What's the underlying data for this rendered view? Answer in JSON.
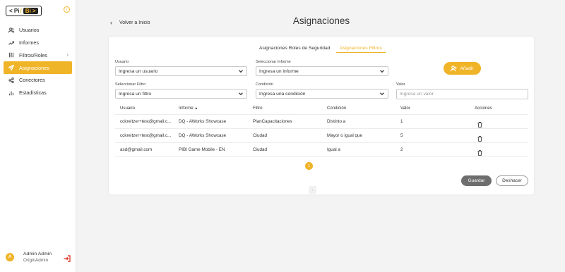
{
  "logo": {
    "pi": "< Pi",
    "slash": "/",
    "bi": "Bi >"
  },
  "sidebar": {
    "items": [
      {
        "label": "Usuarios",
        "icon": "users-icon"
      },
      {
        "label": "Informes",
        "icon": "trend-icon"
      },
      {
        "label": "Filtros/Roles",
        "icon": "sliders-icon"
      },
      {
        "label": "Asignaciones",
        "icon": "send-icon"
      },
      {
        "label": "Conectores",
        "icon": "share-icon"
      },
      {
        "label": "Estadísticas",
        "icon": "bar-chart-icon"
      }
    ],
    "active": "Asignaciones"
  },
  "user": {
    "initial": "A",
    "name": "Admin Admin",
    "role": "OriginAdmin"
  },
  "header": {
    "back_label": "Volver a Inicio",
    "title": "Asignaciones"
  },
  "tabs": [
    "Asignaciones Roles de Seguridad",
    "Asignaciones Filtros"
  ],
  "form": {
    "usuario_label": "Usuario",
    "usuario_value": "Ingresa un usuario",
    "informe_label": "Seleccionar Informe",
    "informe_value": "Ingresa un informe",
    "filtro_label": "Seleccionar Filtro",
    "filtro_value": "Ingresa un filtro",
    "condicion_label": "Condición",
    "condicion_value": "Ingresa una condición",
    "valor_label": "Valor",
    "valor_placeholder": "Ingresa un valor",
    "add_label": "Añadir"
  },
  "table": {
    "headers": [
      "Usuario",
      "Informe",
      "Filtro",
      "Condición",
      "Valor",
      "Acciones"
    ],
    "sort_indicator": "▲",
    "rows": [
      {
        "usuario": "cckreitzer+test@gmail.c...",
        "informe": "DQ - AWorks Showcase",
        "filtro": "PlanCapacitaciones",
        "condicion": "Distinto a",
        "valor": "1"
      },
      {
        "usuario": "cckreitzer+test@gmail.c...",
        "informe": "DQ - AWorks Showcase",
        "filtro": "Ciudad",
        "condicion": "Mayor o igual que",
        "valor": "5"
      },
      {
        "usuario": "asd@gmail.com",
        "informe": "PIBI Game Mobile - EN",
        "filtro": "Ciudad",
        "condicion": "Igual a",
        "valor": "2"
      }
    ]
  },
  "pagination": {
    "prev": "‹",
    "current": "1",
    "next": "›"
  },
  "actions": {
    "save_label": "Guardar",
    "undo_label": "Deshacer"
  },
  "colors": {
    "accent": "#f0b429",
    "danger": "#e0443a"
  }
}
